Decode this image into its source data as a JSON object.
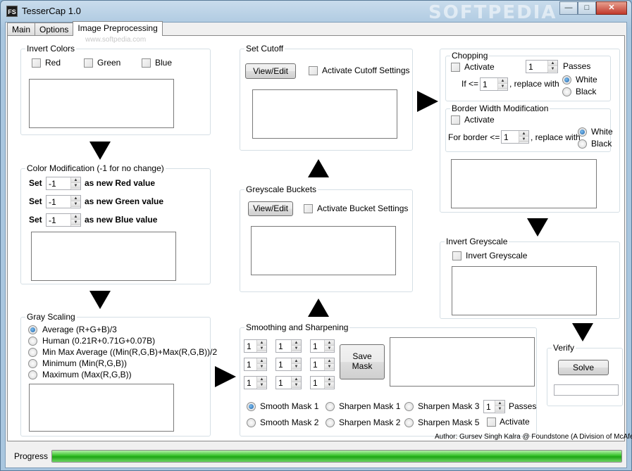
{
  "window": {
    "title": "TesserCap 1.0",
    "icon_text": "FS",
    "watermark": "SOFTPEDIA",
    "small_watermark": "www.softpedia.com"
  },
  "tabs": [
    {
      "label": "Main"
    },
    {
      "label": "Options"
    },
    {
      "label": "Image Preprocessing"
    }
  ],
  "invert_colors": {
    "title": "Invert Colors",
    "options": [
      {
        "label": "Red"
      },
      {
        "label": "Green"
      },
      {
        "label": "Blue"
      }
    ]
  },
  "color_modification": {
    "title": "Color Modification (-1 for no change)",
    "rows": [
      {
        "set": "Set",
        "value": "-1",
        "suffix": "as new Red value"
      },
      {
        "set": "Set",
        "value": "-1",
        "suffix": "as new Green value"
      },
      {
        "set": "Set",
        "value": "-1",
        "suffix": "as new Blue value"
      }
    ]
  },
  "gray_scaling": {
    "title": "Gray Scaling",
    "options": [
      {
        "label": "Average (R+G+B)/3",
        "selected": true
      },
      {
        "label": "Human (0.21R+0.71G+0.07B)",
        "selected": false
      },
      {
        "label": "Min Max Average ((Min(R,G,B)+Max(R,G,B))/2",
        "selected": false
      },
      {
        "label": "Minimum (Min(R,G,B))",
        "selected": false
      },
      {
        "label": "Maximum (Max(R,G,B))",
        "selected": false
      }
    ]
  },
  "set_cutoff": {
    "title": "Set Cutoff",
    "button": "View/Edit",
    "checkbox": "Activate Cutoff Settings"
  },
  "greyscale_buckets": {
    "title": "Greyscale Buckets",
    "button": "View/Edit",
    "checkbox": "Activate Bucket Settings"
  },
  "smoothing": {
    "title": "Smoothing and Sharpening",
    "grid": [
      "1",
      "1",
      "1",
      "1",
      "1",
      "1",
      "1",
      "1",
      "1"
    ],
    "save_mask": "Save\nMask",
    "save_mask_line1": "Save",
    "save_mask_line2": "Mask",
    "radios": [
      {
        "label": "Smooth Mask 1",
        "selected": true
      },
      {
        "label": "Sharpen Mask 1",
        "selected": false
      },
      {
        "label": "Sharpen Mask 3",
        "selected": false
      },
      {
        "label": "Smooth Mask 2",
        "selected": false
      },
      {
        "label": "Sharpen Mask 2",
        "selected": false
      },
      {
        "label": "Sharpen Mask 5",
        "selected": false
      }
    ],
    "passes_value": "1",
    "passes_label": "Passes",
    "activate": "Activate"
  },
  "chopping": {
    "title": "Chopping",
    "activate": "Activate",
    "passes_value": "1",
    "passes_label": "Passes",
    "if_label": "If <=",
    "if_value": "1",
    "replace_label": ", replace with",
    "white": "White",
    "black": "Black"
  },
  "border_width": {
    "title": "Border Width Modification",
    "activate": "Activate",
    "for_label": "For border <=",
    "value": "1",
    "replace_label": ", replace with",
    "white": "White",
    "black": "Black"
  },
  "invert_greyscale": {
    "title": "Invert Greyscale",
    "checkbox": "Invert Greyscale"
  },
  "verify": {
    "title": "Verify",
    "button": "Solve",
    "input_value": ""
  },
  "author": "Author: Gursev Singh Kalra @ Foundstone (A Division of McAfee)",
  "progress": {
    "label": "Progress",
    "value": 1.0
  }
}
